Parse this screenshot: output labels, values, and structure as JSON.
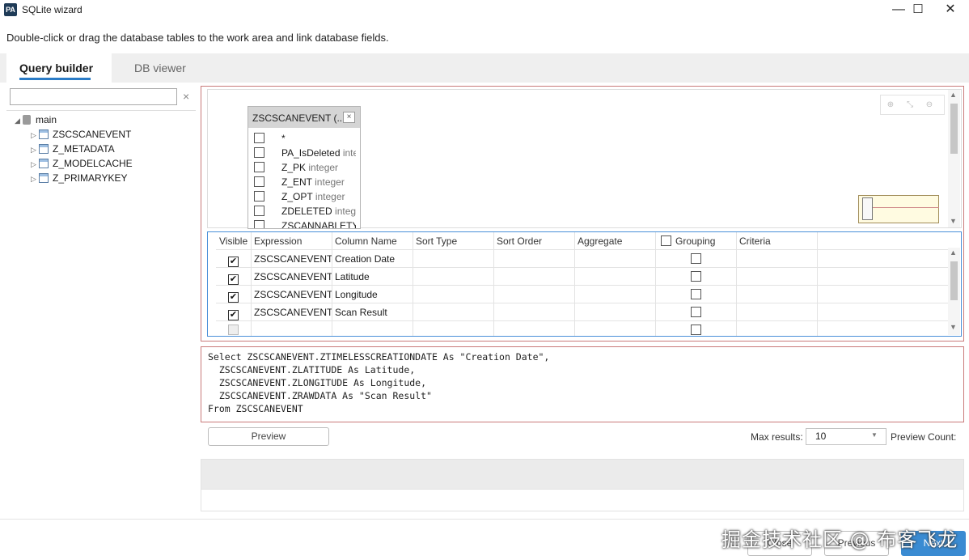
{
  "window": {
    "icon_text": "PA",
    "title": "SQLite wizard",
    "minimize_glyph": "—",
    "maximize_glyph": "☐",
    "close_glyph": "✕"
  },
  "instruction": "Double-click or drag the database tables to the work area and link database fields.",
  "tabs": [
    {
      "label": "Query builder",
      "active": true
    },
    {
      "label": "DB viewer",
      "active": false
    }
  ],
  "tree": {
    "search_value": "",
    "clear_glyph": "×",
    "root": {
      "label": "main",
      "expanded": true
    },
    "tables": [
      "ZSCSCANEVENT",
      "Z_METADATA",
      "Z_MODELCACHE",
      "Z_PRIMARYKEY"
    ]
  },
  "canvas": {
    "zoom_icons": [
      "zoom-in-icon",
      "fit-icon",
      "zoom-out-icon"
    ],
    "table_box": {
      "title": "ZSCSCANEVENT (...",
      "close_glyph": "×",
      "fields": [
        {
          "name": "*",
          "type": ""
        },
        {
          "name": "PA_IsDeleted",
          "type": "integer"
        },
        {
          "name": "Z_PK",
          "type": "integer"
        },
        {
          "name": "Z_ENT",
          "type": "integer"
        },
        {
          "name": "Z_OPT",
          "type": "integer"
        },
        {
          "name": "ZDELETED",
          "type": "integer"
        },
        {
          "name": "ZSCANNABLETY",
          "type": ""
        }
      ]
    }
  },
  "grid": {
    "headers": [
      "Visible",
      "Expression",
      "Column Name",
      "Sort Type",
      "Sort Order",
      "Aggregate",
      "Grouping",
      "Criteria"
    ],
    "rows": [
      {
        "visible": true,
        "expression": "ZSCSCANEVENT.Z",
        "column_name": "Creation Date",
        "grouping": false
      },
      {
        "visible": true,
        "expression": "ZSCSCANEVENT.Z",
        "column_name": "Latitude",
        "grouping": false
      },
      {
        "visible": true,
        "expression": "ZSCSCANEVENT.Z",
        "column_name": "Longitude",
        "grouping": false
      },
      {
        "visible": true,
        "expression": "ZSCSCANEVENT.Z",
        "column_name": "Scan Result",
        "grouping": false
      },
      {
        "visible": false,
        "expression": "",
        "column_name": "",
        "grouping": false
      }
    ]
  },
  "sql": "Select ZSCSCANEVENT.ZTIMELESSCREATIONDATE As \"Creation Date\",\n  ZSCSCANEVENT.ZLATITUDE As Latitude,\n  ZSCSCANEVENT.ZLONGITUDE As Longitude,\n  ZSCSCANEVENT.ZRAWDATA As \"Scan Result\"\nFrom ZSCSCANEVENT",
  "controls": {
    "preview_label": "Preview",
    "max_results_label": "Max results:",
    "max_results_value": "10",
    "preview_count_label": "Preview Count:"
  },
  "footer": {
    "close_label": "Close",
    "previous_label": "Previous",
    "next_label": "Next"
  },
  "watermark": "掘金技术社区 @ 布客飞龙",
  "colors": {
    "accent": "#2a7bc6",
    "next_button": "#3a8bd2",
    "panel_border": "#c97a7a",
    "grid_border": "#4a90d9"
  }
}
